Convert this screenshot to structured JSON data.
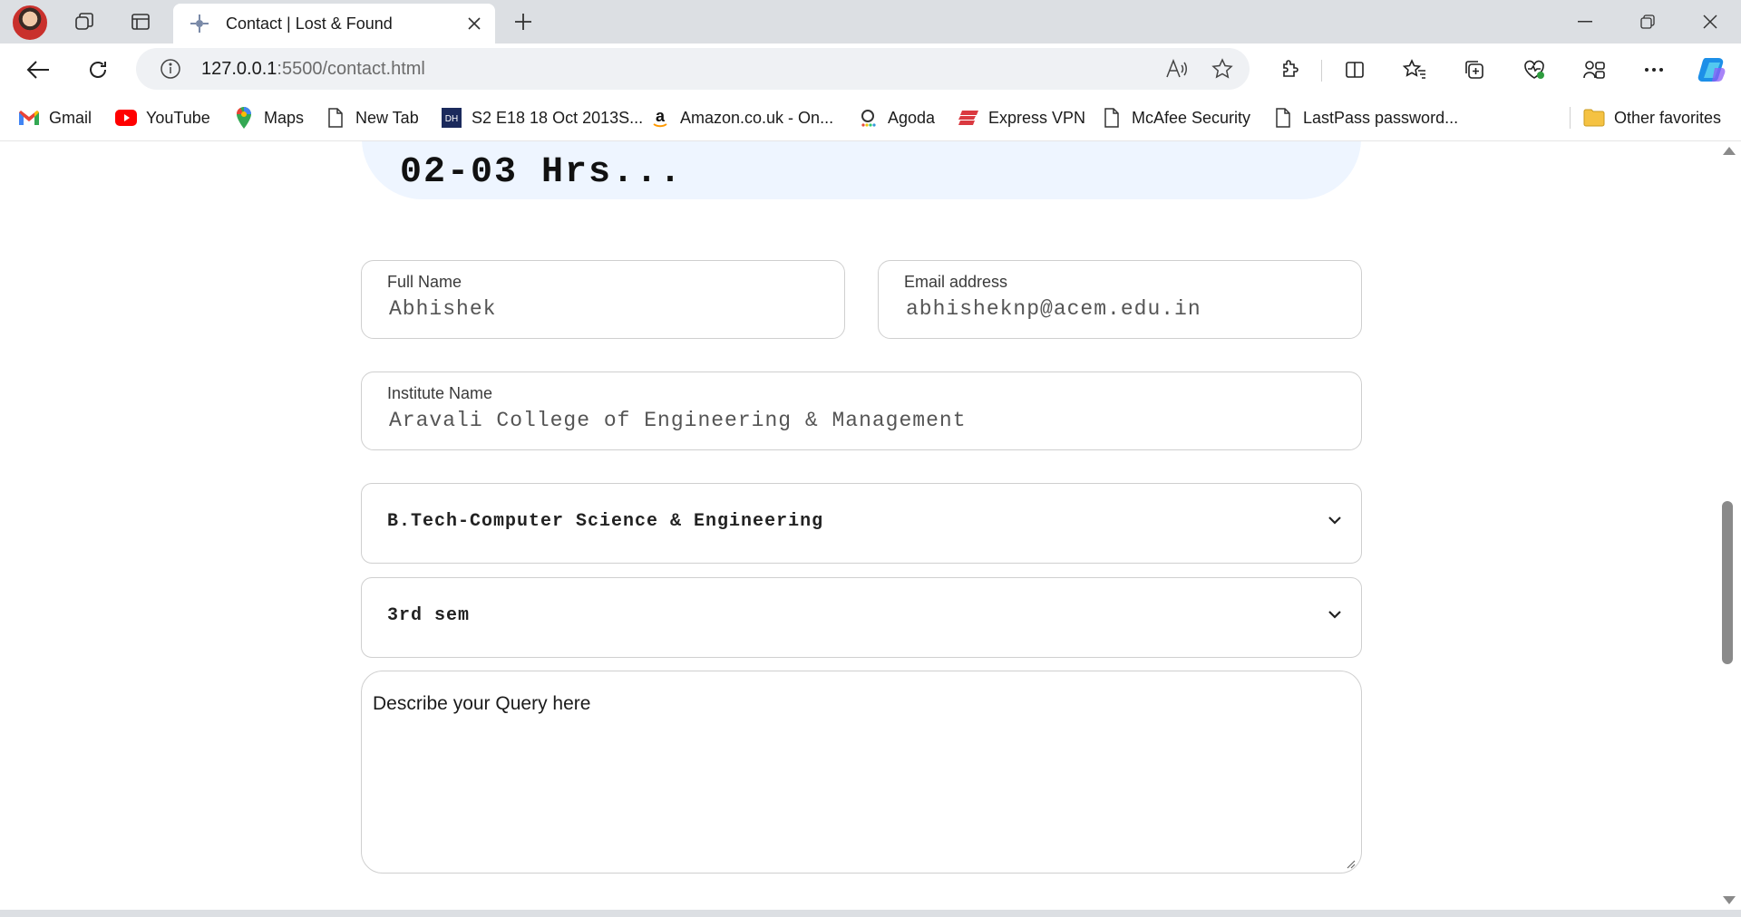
{
  "browser": {
    "tab_title": "Contact | Lost & Found",
    "url_host": "127.0.0.1",
    "url_path": ":5500/contact.html",
    "favorites": [
      {
        "label": "Gmail",
        "icon": "gmail-icon"
      },
      {
        "label": "YouTube",
        "icon": "youtube-icon"
      },
      {
        "label": "Maps",
        "icon": "maps-icon"
      },
      {
        "label": "New Tab",
        "icon": "page-icon"
      },
      {
        "label": "S2 E18 18 Oct 2013S...",
        "icon": "dh-icon"
      },
      {
        "label": "Amazon.co.uk - On...",
        "icon": "amazon-icon"
      },
      {
        "label": "Agoda",
        "icon": "agoda-icon"
      },
      {
        "label": "Express VPN",
        "icon": "expressvpn-icon"
      },
      {
        "label": "McAfee Security",
        "icon": "page-icon"
      },
      {
        "label": "LastPass password...",
        "icon": "page-icon"
      }
    ],
    "other_favorites": "Other favorites"
  },
  "page": {
    "banner_text": "02-03 Hrs...",
    "full_name": {
      "label": "Full Name",
      "value": "Abhishek"
    },
    "email": {
      "label": "Email address",
      "value": "abhisheknp@acem.edu.in"
    },
    "institute": {
      "label": "Institute Name",
      "value": "Aravali College of Engineering & Management"
    },
    "course_select": {
      "value": "B.Tech-Computer Science & Engineering"
    },
    "semester_select": {
      "value": "3rd sem"
    },
    "query_textarea": {
      "placeholder": "Describe your Query here"
    }
  },
  "colors": {
    "banner_bg": "#eef5ff",
    "field_border": "#cfcfcf",
    "tabstrip_bg": "#dcdfe3"
  }
}
